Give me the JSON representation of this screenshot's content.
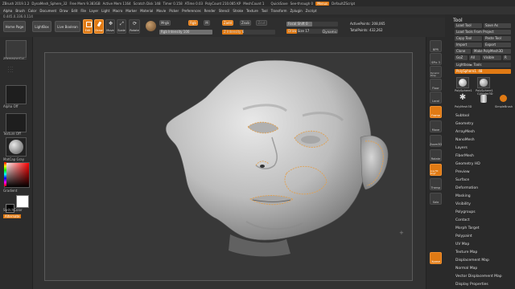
{
  "topbar": {
    "items": [
      "ZBrush 2019.1.2",
      "DynaMesh_Sphere_32",
      "Free Mem 9.383GB",
      "Active Mem 1164",
      "Scratch Disk 148",
      "Timer 0.158",
      "ATime 0.03",
      "PolyCount 210.085 KP",
      "MeshCount 1"
    ],
    "quicksave": "QuickSave",
    "see_through": "See-through 0",
    "menus_btn": "Menus",
    "script": "DefaultZScript"
  },
  "menubar": [
    "Alpha",
    "Brush",
    "Color",
    "Document",
    "Draw",
    "Edit",
    "File",
    "Layer",
    "Light",
    "Macro",
    "Marker",
    "Material",
    "Movie",
    "Picker",
    "Preferences",
    "Render",
    "Stencil",
    "Stroke",
    "Texture",
    "Tool",
    "Transform",
    "Zplugin",
    "Zscript"
  ],
  "coord": "0.445,0.336,0.114",
  "shelf": {
    "home_page": "Home Page",
    "lightbox": "LightBox",
    "live_boolean": "Live Boolean",
    "tools": [
      {
        "label": "Edit",
        "icon": "edit-icon",
        "active": true
      },
      {
        "label": "Draw",
        "icon": "draw-icon",
        "active": true
      },
      {
        "label": "Move",
        "icon": "move-icon",
        "active": false
      },
      {
        "label": "Scale",
        "icon": "scale-icon",
        "active": false
      },
      {
        "label": "Rotate",
        "icon": "rotate-icon",
        "active": false
      }
    ],
    "mrgb": "Mrgb",
    "rgb": "Rgb",
    "m": "M",
    "rgb_intensity": "Rgb Intensity 100",
    "zadd": "Zadd",
    "zsub": "Zsub",
    "zcut": "Zcut",
    "z_intensity": "Z Intensity 6",
    "focal_shift": "Focal Shift 0",
    "draw_size": "Draw Size 17",
    "dynamic": "Dynamic",
    "active_points": "ActivePoints: 208,065",
    "total_points": "TotalPoints: 432,262"
  },
  "left_panel": {
    "brush": "ZRemesherGui...",
    "alpha": "Alpha Off",
    "texture": "Texture Off",
    "material": "MatCap Gray",
    "gradient": "Gradient",
    "switch_color": "SwitchColor",
    "alternate": "Alternate"
  },
  "right_shelf": [
    "BPR",
    "SPix 3",
    "Dynamic Persp",
    "Floor",
    "Local",
    "Frame",
    "Move",
    "Zoom3D",
    "Rotate",
    "Line Fill PolyF",
    "Transp",
    "Solo",
    "Xpose"
  ],
  "tray": {
    "title": "Tool",
    "buttons_row1": [
      "Load Tool",
      "Save As"
    ],
    "buttons_row2": [
      "Load Tools From Project"
    ],
    "buttons_row3": [
      "Copy Tool",
      "Paste Tool"
    ],
    "buttons_row4": [
      "Import",
      "Export"
    ],
    "buttons_row5": [
      "Clone",
      "Make PolyMesh3D"
    ],
    "buttons_row6": [
      "GoZ",
      "All",
      "Visible",
      "R"
    ],
    "lightbox_tools": "Lightbox► Tools",
    "polysphere": "PolySphere1. 48",
    "thumbs": [
      "PolySphere1",
      "PolySphere1",
      "Cylinder3D",
      "PolyMesh3D",
      "SimpleBrush"
    ],
    "subpalettes": [
      "Subtool",
      "Geometry",
      "ArrayMesh",
      "NanoMesh",
      "Layers",
      "FiberMesh",
      "Geometry HD",
      "Preview",
      "Surface",
      "Deformation",
      "Masking",
      "Visibility",
      "Polygroups",
      "Contact",
      "Morph Target",
      "Polypaint",
      "UV Map",
      "Texture Map",
      "Displacement Map",
      "Normal Map",
      "Vector Displacement Map",
      "Display Properties"
    ]
  },
  "colors": {
    "accent": "#e07a14",
    "panel": "#2b2b2b",
    "viewport": "#383838"
  }
}
